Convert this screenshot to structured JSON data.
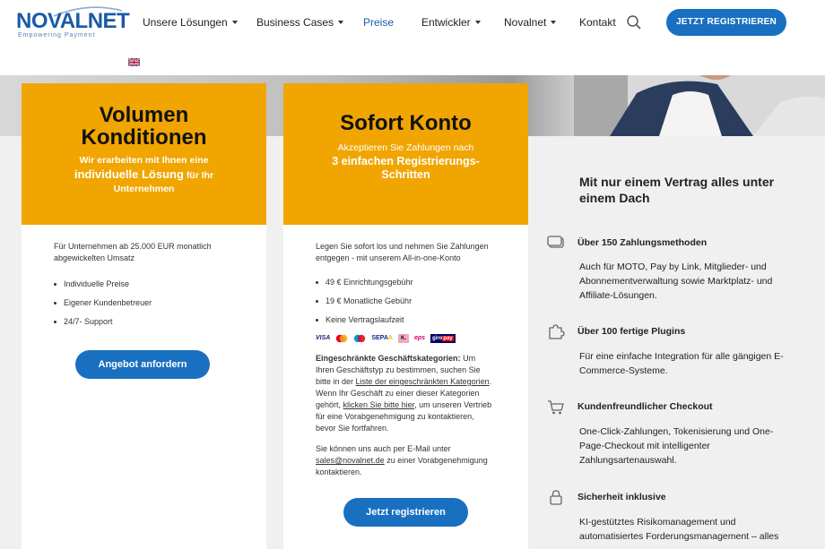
{
  "header": {
    "logo_text": "NOVALNET",
    "logo_tagline": "Empowering Payment",
    "nav": [
      {
        "label": "Unsere Lösungen",
        "caret": true
      },
      {
        "label": "Business Cases",
        "caret": true
      },
      {
        "label": "Preise",
        "caret": false,
        "active": true
      },
      {
        "label": "Entwickler",
        "caret": true
      },
      {
        "label": "Novalnet",
        "caret": true
      },
      {
        "label": "Kontakt",
        "caret": false
      }
    ],
    "cta_label": "JETZT REGISTRIEREN",
    "language": "en-gb-flag"
  },
  "card1": {
    "title_line1": "Volumen",
    "title_line2": "Konditionen",
    "sub_line1": "Wir erarbeiten mit Ihnen eine",
    "sub_big": "individuelle Lösung",
    "sub_line2_rest": "für Ihr",
    "sub_line3": "Unternehmen",
    "intro": "Für Unternehmen ab 25.000 EUR monatlich abgewickelten Umsatz",
    "bullets": [
      "Individuelle Preise",
      "Eigener Kundenbetreuer",
      "24/7- Support"
    ],
    "button": "Angebot anfordern"
  },
  "card2": {
    "title": "Sofort Konto",
    "sub_line1": "Akzeptieren Sie Zahlungen nach",
    "sub_big1": "3 einfachen Registrierungs-",
    "sub_big2": "Schritten",
    "intro": "Legen Sie sofort los und nehmen Sie Zahlungen entgegen - mit unserem All-in-one-Konto",
    "bullets": [
      "49 € Einrichtungsgebühr",
      "19 € Monatliche Gebühr",
      "Keine Vertragslaufzeit"
    ],
    "payment_logos": [
      "VISA",
      "Mastercard",
      "Maestro",
      "SEPA",
      "Klarna",
      "eps",
      "giropay"
    ],
    "restricted_title": "Eingeschränkte Geschäftskategorien:",
    "restricted_text1": "Um Ihren Geschäftstyp zu bestimmen, suchen Sie bitte in der",
    "restricted_link1": "Liste der eingeschränkten Kategorien",
    "restricted_text2": ". Wenn Ihr Geschäft zu einer dieser Kategorien gehört,",
    "restricted_link2": "klicken Sie bitte hier",
    "restricted_text3": ", um unseren Vertrieb für eine Vorabgenehmigung zu kontaktieren, bevor Sie fortfahren.",
    "email_text1": "Sie können uns auch per E-Mail unter",
    "email_link": "sales@novalnet.de",
    "email_text2": "zu einer Vorabgenehmigung kontaktieren.",
    "button": "Jetzt registrieren"
  },
  "right": {
    "heading": "Mit nur einem Vertrag alles unter einem Dach",
    "features": [
      {
        "icon": "card-icon",
        "title": "Über 150 Zahlungsmethoden",
        "text": "Auch für MOTO, Pay by Link, Mitglieder- und Abonnementverwaltung sowie Marktplatz- und Affiliate-Lösungen."
      },
      {
        "icon": "puzzle-icon",
        "title": "Über 100 fertige Plugins",
        "text": "Für eine einfache Integration für alle gängigen E-Commerce-Systeme."
      },
      {
        "icon": "cart-icon",
        "title": "Kundenfreundlicher Checkout",
        "text": "One-Click-Zahlungen, Tokenisierung und One-Page-Checkout mit intelligenter Zahlungsartenauswahl."
      },
      {
        "icon": "lock-icon",
        "title": "Sicherheit inklusive",
        "text": "KI-gestütztes Risikomanagement und automatisiertes Forderungsmanagement – alles"
      }
    ]
  },
  "colors": {
    "brand_blue": "#1a70c0",
    "orange": "#f0a500"
  }
}
